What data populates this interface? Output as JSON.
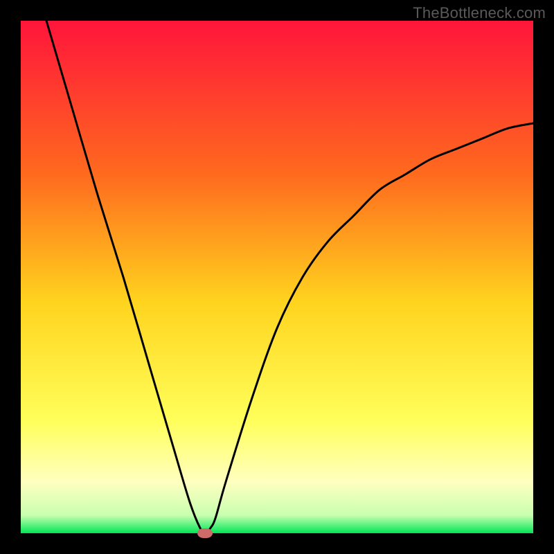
{
  "watermark": "TheBottleneck.com",
  "colors": {
    "background": "#000000",
    "gradient_top": "#ff153b",
    "gradient_mid_upper": "#ff8a1e",
    "gradient_mid": "#ffe31e",
    "gradient_lower": "#ffff8a",
    "gradient_bottom": "#00e756",
    "curve": "#000000",
    "marker": "#cd6b6b",
    "watermark_text": "#5a5a5a"
  },
  "chart_data": {
    "type": "line",
    "title": "",
    "xlabel": "",
    "ylabel": "",
    "xlim": [
      0,
      100
    ],
    "ylim": [
      0,
      100
    ],
    "series": [
      {
        "name": "bottleneck-curve",
        "x": [
          5,
          10,
          15,
          20,
          25,
          30,
          33,
          35,
          36,
          37,
          38,
          40,
          45,
          50,
          55,
          60,
          65,
          70,
          75,
          80,
          85,
          90,
          95,
          100
        ],
        "y": [
          100,
          83,
          66,
          50,
          33,
          16,
          6,
          1,
          0,
          1,
          3,
          10,
          26,
          40,
          50,
          57,
          62,
          67,
          70,
          73,
          75,
          77,
          79,
          80
        ]
      }
    ],
    "marker": {
      "x": 36,
      "y": 0
    },
    "gradient_stops": [
      {
        "pos": 0.0,
        "color": "#ff153b"
      },
      {
        "pos": 0.3,
        "color": "#ff6a1e"
      },
      {
        "pos": 0.55,
        "color": "#ffd41e"
      },
      {
        "pos": 0.78,
        "color": "#ffff5a"
      },
      {
        "pos": 0.9,
        "color": "#ffffc0"
      },
      {
        "pos": 0.965,
        "color": "#c8ffb0"
      },
      {
        "pos": 1.0,
        "color": "#00e756"
      }
    ]
  }
}
